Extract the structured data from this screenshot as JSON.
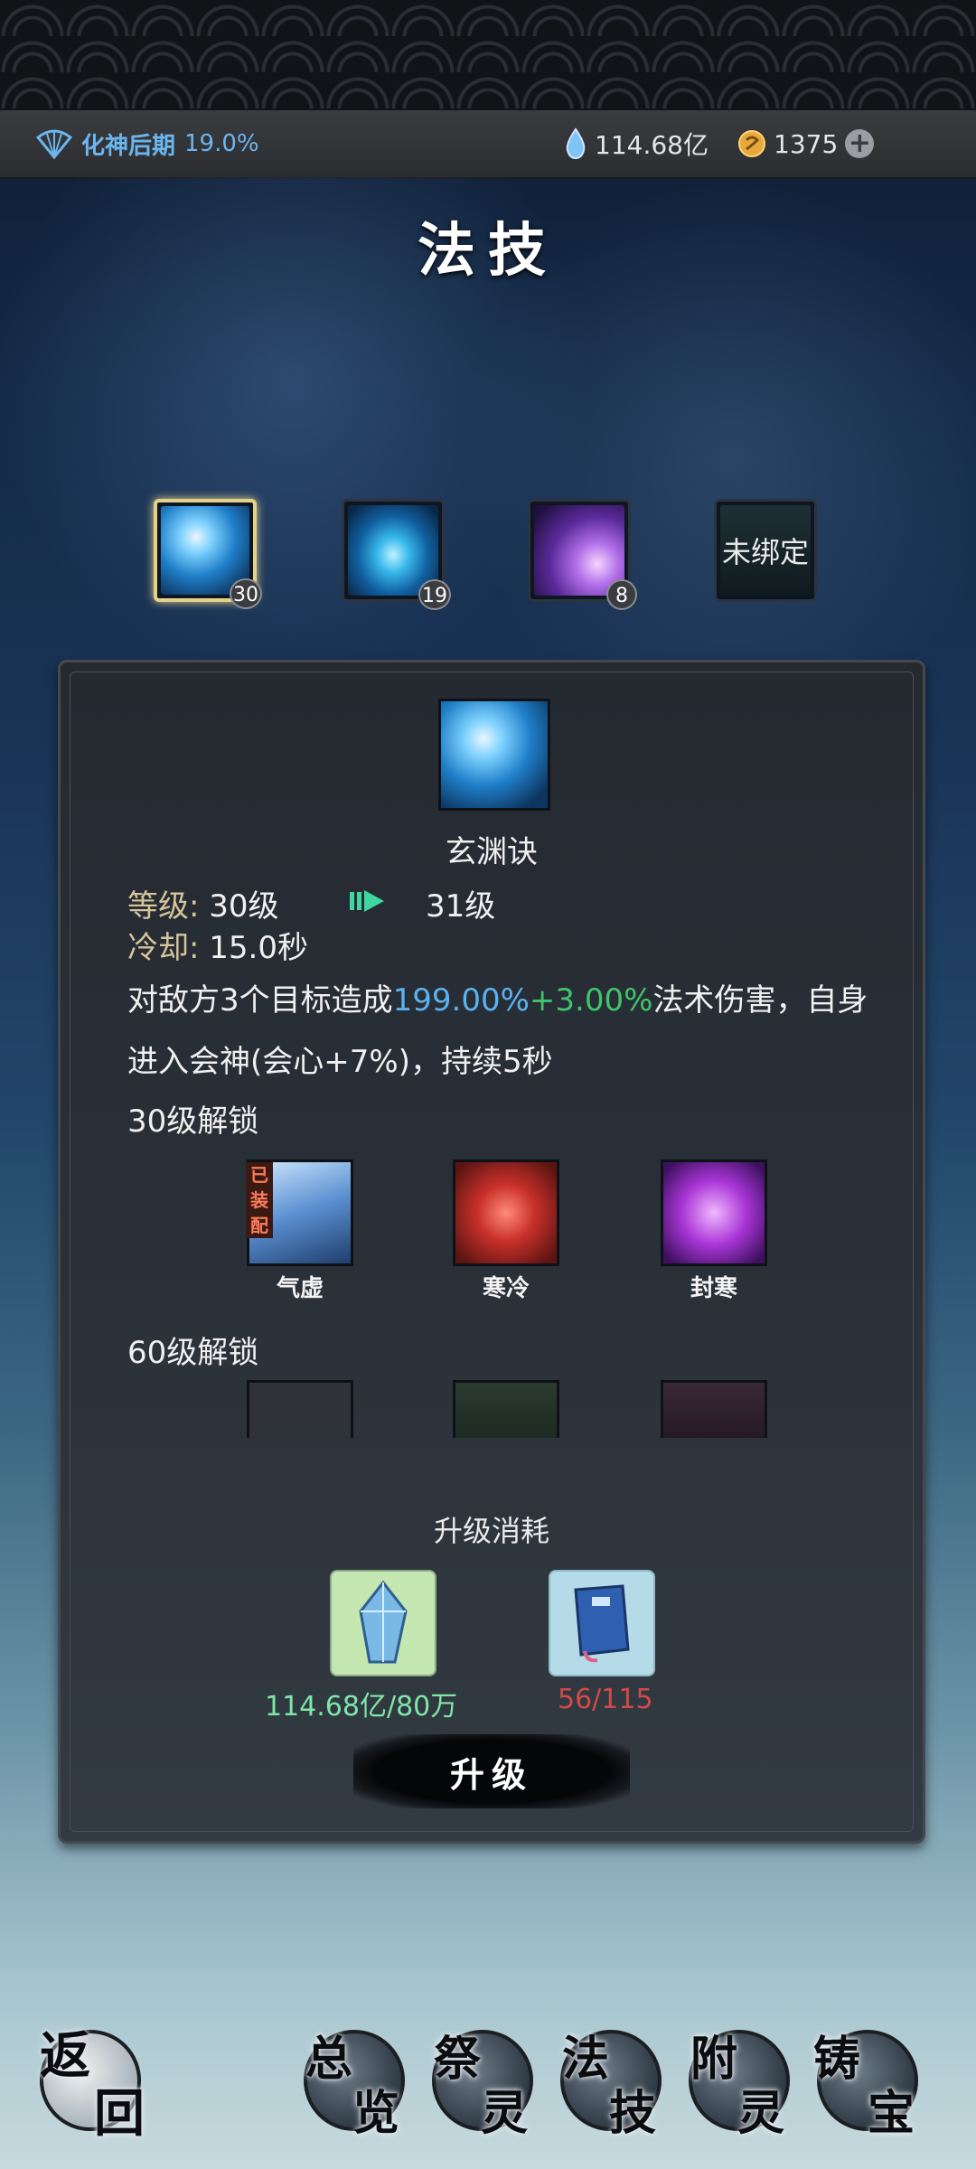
{
  "status": {
    "realm_name": "化神后期",
    "realm_progress": "19.0%",
    "spirit_stones": "114.68亿",
    "gold": "1375"
  },
  "page_title": "法技",
  "skill_slots": [
    {
      "level": "30",
      "selected": true
    },
    {
      "level": "19",
      "selected": false
    },
    {
      "level": "8",
      "selected": false
    },
    {
      "label": "未绑定"
    }
  ],
  "detail": {
    "name": "玄渊诀",
    "level_label": "等级:",
    "level_current": "30级",
    "level_next": "31级",
    "cooldown_label": "冷却:",
    "cooldown_value": "15.0秒",
    "desc_part1": "对敌方3个目标造成",
    "desc_dmg": "199.00%",
    "desc_bonus": "+3.00%",
    "desc_part2": "法术伤害，自身进入会神(会心+7%)，持续5秒",
    "unlock30_title": "30级解锁",
    "unlock30_runes": [
      {
        "name": "气虚",
        "equipped_tag": "已装配"
      },
      {
        "name": "寒冷"
      },
      {
        "name": "封寒"
      }
    ],
    "unlock60_title": "60级解锁",
    "cost_title": "升级消耗",
    "cost_stone": "114.68亿/80万",
    "cost_book": "56/115",
    "upgrade_label": "升级"
  },
  "nav": {
    "back": [
      "返",
      "回"
    ],
    "overview": [
      "总",
      "览"
    ],
    "sacrifice": [
      "祭",
      "灵"
    ],
    "skills": [
      "法",
      "技"
    ],
    "attach": [
      "附",
      "灵"
    ],
    "forge": [
      "铸",
      "宝"
    ]
  },
  "colors": {
    "realm_text": "#6bb6ee",
    "damage_blue": "#5ab2f0",
    "bonus_green": "#3fc46a",
    "cost_ok": "#7fe6a8",
    "cost_insufficient": "#d14a4a"
  }
}
